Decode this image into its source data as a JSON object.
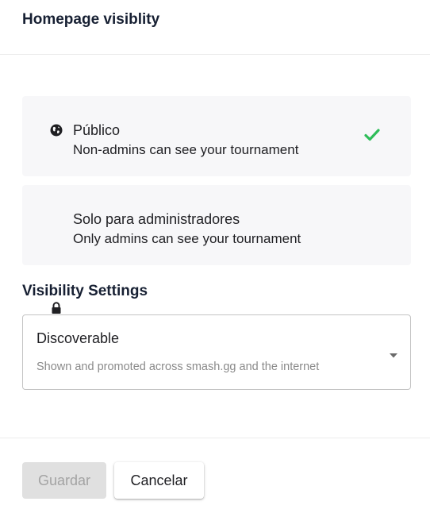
{
  "header": {
    "title": "Homepage visiblity"
  },
  "options": [
    {
      "title": "Público",
      "description": "Non-admins can see your tournament",
      "icon": "globe-icon",
      "selected": true
    },
    {
      "title": "Solo para administradores",
      "description": "Only admins can see your tournament",
      "icon": "lock-icon",
      "selected": false
    }
  ],
  "visibility": {
    "section_title": "Visibility Settings",
    "selected_value": "Discoverable",
    "helper_text": "Shown and promoted across smash.gg and the internet"
  },
  "footer": {
    "save_label": "Guardar",
    "cancel_label": "Cancelar"
  },
  "colors": {
    "check": "#2ebd59",
    "option_bg": "#f7f7f9",
    "disabled_button": "#e0e0e0"
  }
}
